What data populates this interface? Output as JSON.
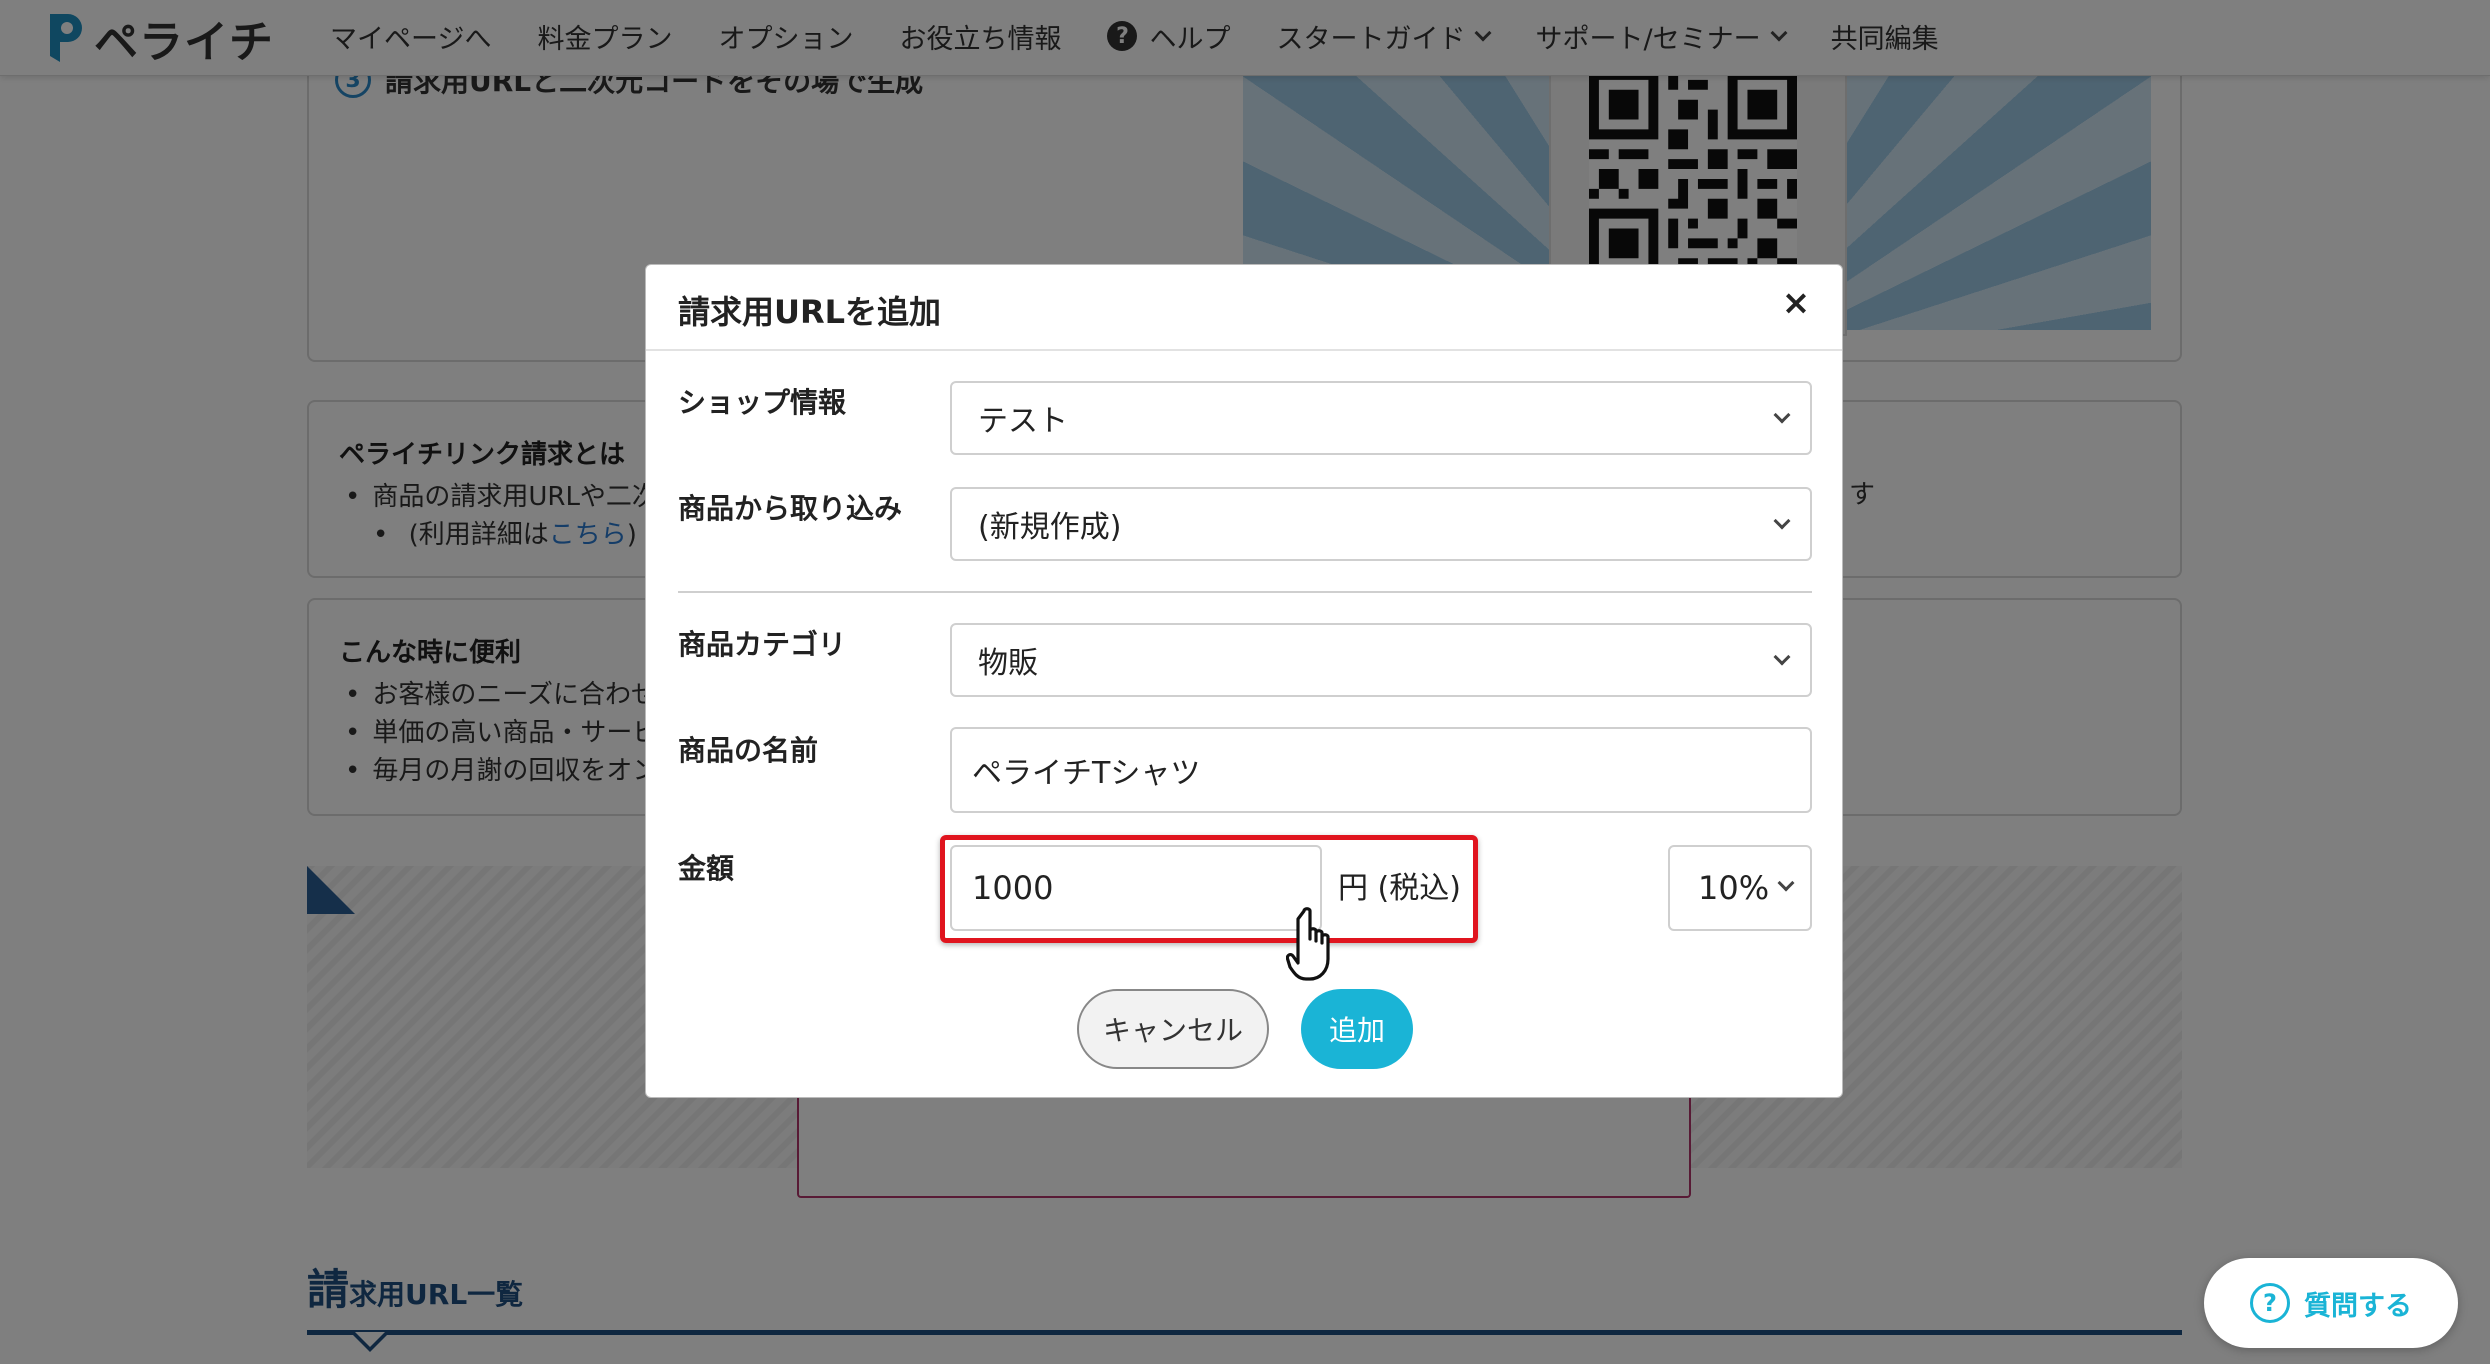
{
  "header": {
    "logo_text": "ペライチ",
    "nav": [
      {
        "label": "マイページへ"
      },
      {
        "label": "料金プラン"
      },
      {
        "label": "オプション"
      },
      {
        "label": "お役立ち情報"
      },
      {
        "label": "ヘルプ"
      },
      {
        "label": "スタートガイド"
      },
      {
        "label": "サポート/セミナー"
      },
      {
        "label": "共同編集"
      }
    ]
  },
  "background": {
    "step_number": "3",
    "step_text": "請求用URLと二次元コードをその場で生成",
    "about": {
      "title": "ペライチリンク請求とは",
      "line1": "商品の請求用URLや二次",
      "line2_prefix": "(利用詳細は",
      "line2_link": "こちら",
      "line2_suffix": ")",
      "overflow": "す"
    },
    "useful": {
      "title": "こんな時に便利",
      "items": [
        "お客様のニーズに合わせ",
        "単価の高い商品・サービ",
        "毎月の月謝の回収をオン"
      ]
    },
    "list_heading_big": "請",
    "list_heading_rest": "求用URL一覧"
  },
  "ask_button": {
    "label": "質問する"
  },
  "modal": {
    "title": "請求用URLを追加",
    "close_label": "×",
    "shop": {
      "label": "ショップ情報",
      "value": "テスト"
    },
    "import": {
      "label": "商品から取り込み",
      "value": "(新規作成)"
    },
    "category": {
      "label": "商品カテゴリ",
      "value": "物販"
    },
    "name": {
      "label": "商品の名前",
      "value": "ペライチTシャツ"
    },
    "amount": {
      "label": "金額",
      "value": "1000",
      "unit": "円 (税込)",
      "tax_rate": "10%"
    },
    "cancel_label": "キャンセル",
    "add_label": "追加"
  },
  "colors": {
    "accent": "#1ab4d6",
    "highlight": "#e0141e",
    "heading": "#1f4f80"
  }
}
